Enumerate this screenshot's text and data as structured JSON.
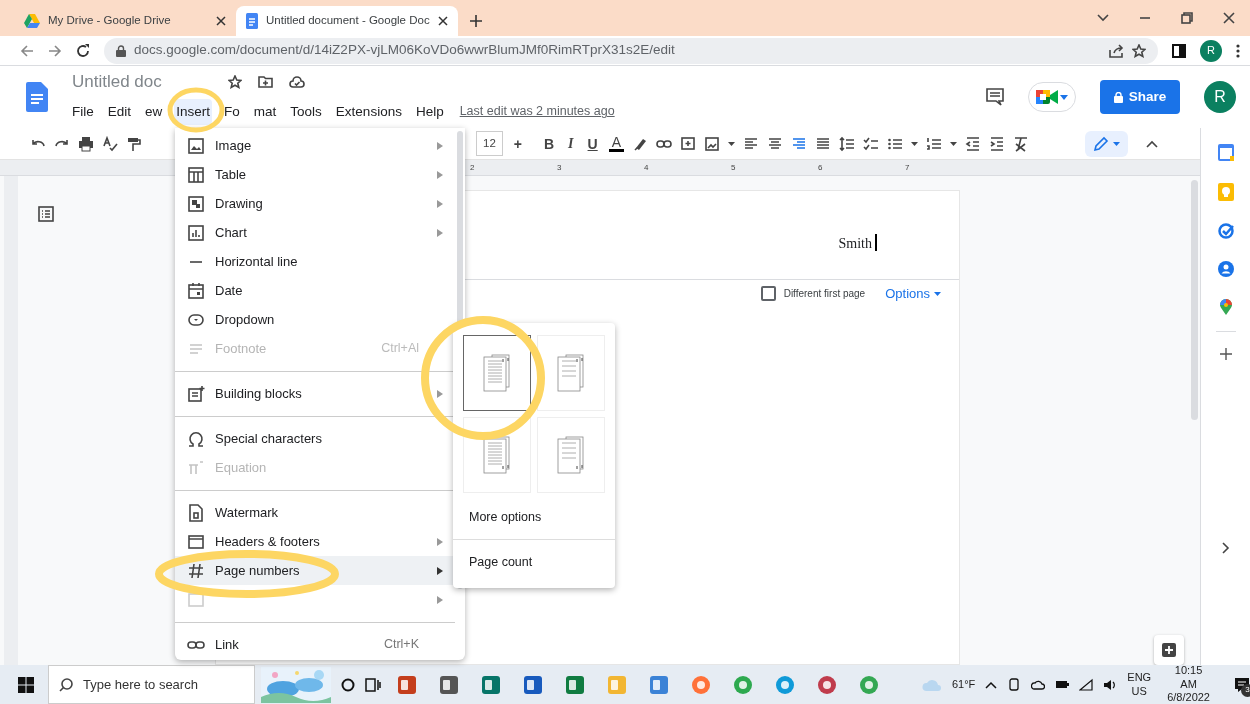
{
  "browser": {
    "tabs": [
      {
        "title": "My Drive - Google Drive",
        "selected": false
      },
      {
        "title": "Untitled document - Google Doc",
        "selected": true
      }
    ],
    "url": "docs.google.com/document/d/14iZ2PX-vjLM06KoVDo6wwrBlumJMf0RimRTprX31s2E/edit",
    "profile": "R"
  },
  "doc": {
    "title": "Untitled doc",
    "menus": [
      {
        "label": "File",
        "selected": false
      },
      {
        "label": "Edit",
        "selected": false
      },
      {
        "label": "ew",
        "selected": false
      },
      {
        "label": "Insert",
        "selected": true
      },
      {
        "label": "Fo",
        "label_tail": "mat",
        "selected": false
      },
      {
        "label": "Tools",
        "selected": false
      },
      {
        "label": "Extensions",
        "selected": false
      },
      {
        "label": "Help",
        "selected": false
      }
    ],
    "last_edit": "Last edit was 2 minutes ago",
    "share": "Share",
    "avatar": "R"
  },
  "toolbar": {
    "font_size": "12",
    "increase": "+",
    "bold": "B",
    "italic": "I",
    "underline": "U",
    "text_color": "A"
  },
  "ruler": [
    "2",
    "3",
    "4",
    "5",
    "6",
    "7"
  ],
  "page": {
    "header_text": "Smith",
    "different_first_page": {
      "label": "Different first page",
      "checked": false
    },
    "options": "Options"
  },
  "insert_menu": [
    {
      "kind": "item",
      "label": "Image",
      "submenu": true,
      "disabled": false,
      "selected": false
    },
    {
      "kind": "item",
      "label": "Table",
      "submenu": true,
      "disabled": false,
      "selected": false
    },
    {
      "kind": "item",
      "label": "Drawing",
      "submenu": true,
      "disabled": false,
      "selected": false
    },
    {
      "kind": "item",
      "label": "Chart",
      "submenu": true,
      "disabled": false,
      "selected": false
    },
    {
      "kind": "item",
      "label": "Horizontal line",
      "submenu": false,
      "disabled": false,
      "selected": false
    },
    {
      "kind": "item",
      "label": "Date",
      "submenu": false,
      "disabled": false,
      "selected": false
    },
    {
      "kind": "item",
      "label": "Dropdown",
      "submenu": false,
      "disabled": false,
      "selected": false
    },
    {
      "kind": "item",
      "label": "Footnote",
      "shortcut": "Ctrl+Al",
      "submenu": false,
      "disabled": true,
      "selected": false
    },
    {
      "kind": "divider"
    },
    {
      "kind": "item",
      "label": "Building blocks",
      "submenu": true,
      "disabled": false,
      "selected": false
    },
    {
      "kind": "divider"
    },
    {
      "kind": "item",
      "label": "Special characters",
      "submenu": false,
      "disabled": false,
      "selected": false
    },
    {
      "kind": "item",
      "label": "Equation",
      "submenu": false,
      "disabled": true,
      "selected": false
    },
    {
      "kind": "divider"
    },
    {
      "kind": "item",
      "label": "Watermark",
      "submenu": false,
      "disabled": false,
      "selected": false
    },
    {
      "kind": "item",
      "label": "Headers & footers",
      "submenu": true,
      "disabled": false,
      "selected": false
    },
    {
      "kind": "item",
      "label": "Page numbers",
      "submenu": true,
      "disabled": false,
      "selected": true
    },
    {
      "kind": "covered",
      "submenu": true
    },
    {
      "kind": "divider"
    },
    {
      "kind": "item",
      "label": "Link",
      "shortcut": "Ctrl+K",
      "submenu": false,
      "disabled": false,
      "selected": false
    }
  ],
  "page_numbers_menu": {
    "layouts": [
      {
        "selected": true
      },
      {
        "selected": false
      },
      {
        "selected": false
      },
      {
        "selected": false
      }
    ],
    "items": [
      "More options",
      "Page count"
    ]
  },
  "taskbar": {
    "search_placeholder": "Type here to search",
    "weather": "61°F",
    "language": "ENG",
    "region": "US",
    "time": "10:15 AM",
    "date": "6/8/2022",
    "notifications": "3"
  }
}
